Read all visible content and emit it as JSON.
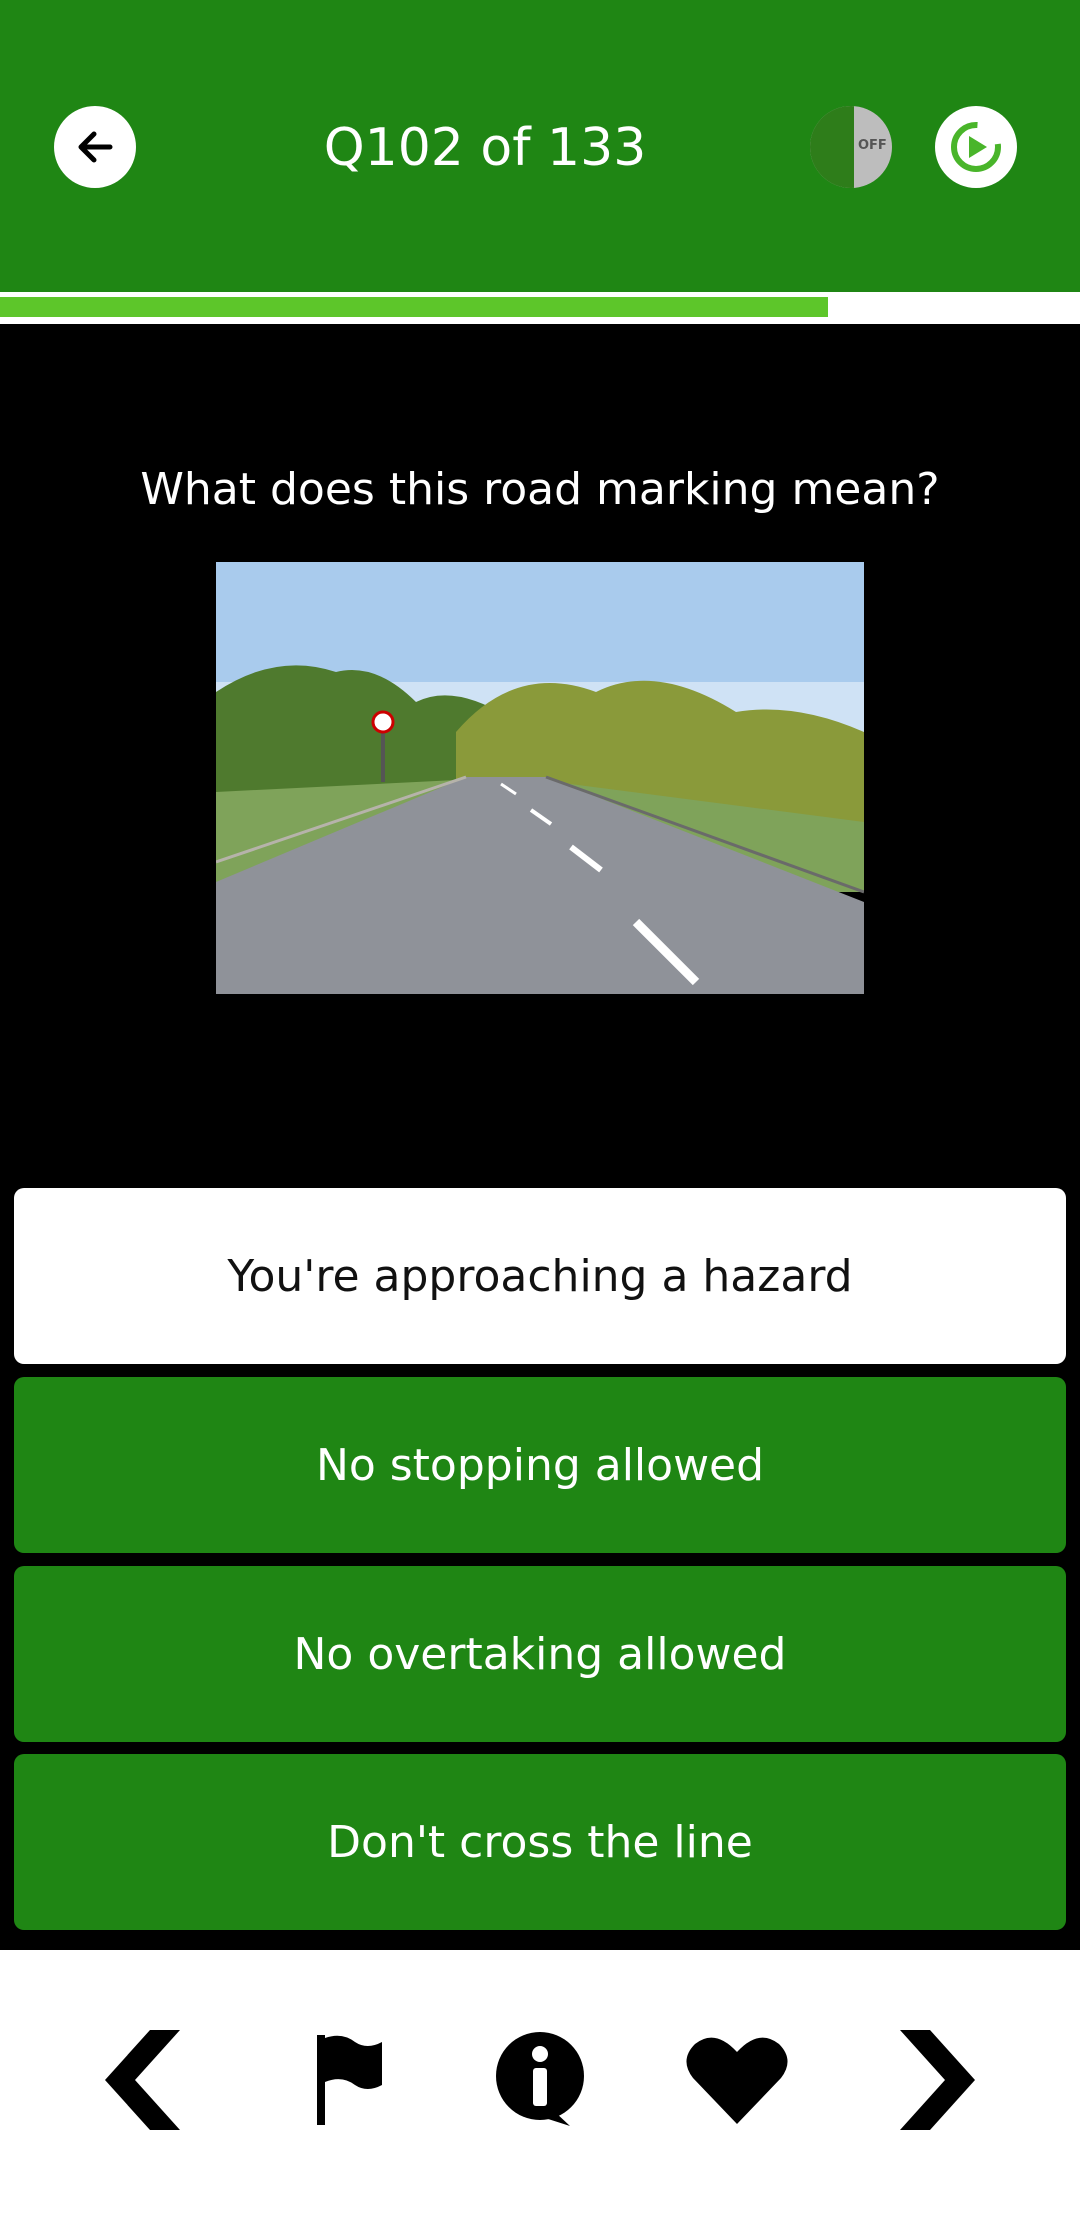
{
  "header": {
    "title": "Q102 of 133",
    "back_icon": "arrow-left-icon",
    "voice_icon": "voice-off-icon",
    "voice_label": "OFF",
    "refresh_icon": "replay-icon"
  },
  "progress": {
    "current": 102,
    "total": 133,
    "fraction": 0.767
  },
  "question": {
    "text": "What does this road marking mean?",
    "image": "road-marking-photo"
  },
  "answers": [
    {
      "label": "You're approaching a hazard",
      "selected": true
    },
    {
      "label": "No stopping allowed",
      "selected": false
    },
    {
      "label": "No overtaking allowed",
      "selected": false
    },
    {
      "label": "Don't cross the line",
      "selected": false
    }
  ],
  "bottom_nav": {
    "items": [
      "previous-icon",
      "flag-icon",
      "info-icon",
      "favorite-icon",
      "next-icon"
    ]
  },
  "colors": {
    "header_green": "#1f8614",
    "progress_green": "#5dc62a",
    "answer_green": "#1f8614",
    "background": "#000000"
  }
}
